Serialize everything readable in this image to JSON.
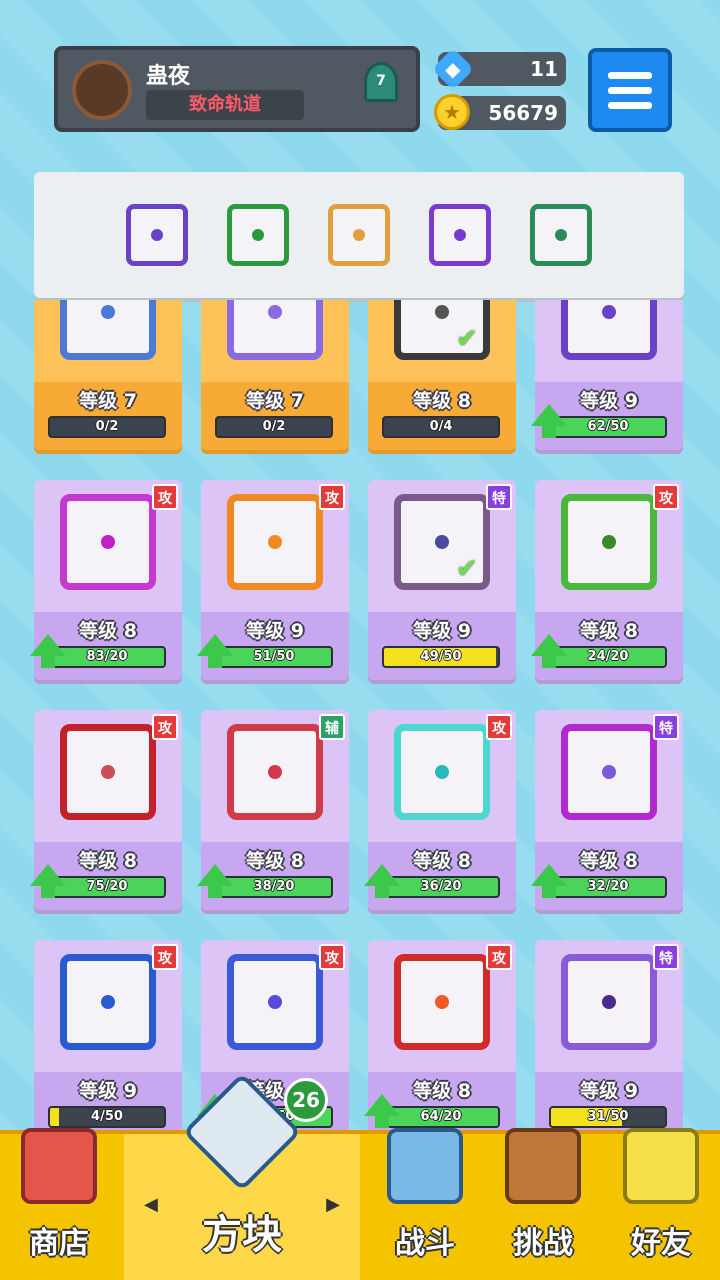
{
  "player": {
    "name": "蛊夜",
    "title": "致命轨道",
    "rank": "7"
  },
  "currency": {
    "gems": "11",
    "coins": "56679"
  },
  "colors": {
    "green": "#4ad45a",
    "yellow": "#f3e11e",
    "attack": "#e43a3a",
    "support": "#2aa36a",
    "special": "#8a3ee0"
  },
  "equipped": [
    {
      "name": "saw-dice",
      "color": "#6a42c8"
    },
    {
      "name": "poison-dice",
      "color": "#2a9a3a"
    },
    {
      "name": "rainbow-dice",
      "color": "#e0a040"
    },
    {
      "name": "orbit-dice",
      "color": "#7a3ad0"
    },
    {
      "name": "wind-dice",
      "color": "#2a8a5a"
    }
  ],
  "cards": [
    {
      "level": "等级 7",
      "progress": "0/2",
      "fill": 0,
      "bar": "green",
      "tag": "",
      "frame": "#4a7ad6",
      "pip": "#4a7ad6",
      "orange": true,
      "arrow": false,
      "check": false
    },
    {
      "level": "等级 7",
      "progress": "0/2",
      "fill": 0,
      "bar": "green",
      "tag": "",
      "frame": "#8a6ae0",
      "pip": "#8a6ae0",
      "orange": true,
      "arrow": false,
      "check": false
    },
    {
      "level": "等级 8",
      "progress": "0/4",
      "fill": 0,
      "bar": "green",
      "tag": "",
      "frame": "#3a3a3a",
      "pip": "#555",
      "orange": true,
      "arrow": false,
      "check": true
    },
    {
      "level": "等级 9",
      "progress": "62/50",
      "fill": 1,
      "bar": "green",
      "tag": "",
      "frame": "#6a42c8",
      "pip": "#6a42c8",
      "orange": false,
      "arrow": true,
      "check": false
    },
    {
      "level": "等级 8",
      "progress": "83/20",
      "fill": 1,
      "bar": "green",
      "tag": "攻",
      "tagtype": "atk",
      "frame": "#c43ad0",
      "pip": "#c020c8",
      "orange": false,
      "arrow": true,
      "check": false
    },
    {
      "level": "等级 9",
      "progress": "51/50",
      "fill": 1,
      "bar": "green",
      "tag": "攻",
      "tagtype": "atk",
      "frame": "#f08a20",
      "pip": "#f08a20",
      "orange": false,
      "arrow": true,
      "check": false
    },
    {
      "level": "等级 9",
      "progress": "49/50",
      "fill": 0.98,
      "bar": "yellow",
      "tag": "特",
      "tagtype": "spc",
      "frame": "#7a5a8a",
      "pip": "#4a4aa0",
      "orange": false,
      "arrow": false,
      "check": true
    },
    {
      "level": "等级 8",
      "progress": "24/20",
      "fill": 1,
      "bar": "green",
      "tag": "攻",
      "tagtype": "atk",
      "frame": "#4ab83a",
      "pip": "#3a8a2a",
      "orange": false,
      "arrow": true,
      "check": false
    },
    {
      "level": "等级 8",
      "progress": "75/20",
      "fill": 1,
      "bar": "green",
      "tag": "攻",
      "tagtype": "atk",
      "frame": "#c4202a",
      "pip": "#d04a5a",
      "orange": false,
      "arrow": true,
      "check": false
    },
    {
      "level": "等级 8",
      "progress": "38/20",
      "fill": 1,
      "bar": "green",
      "tag": "辅",
      "tagtype": "sup",
      "frame": "#d03a4a",
      "pip": "#d03a4a",
      "orange": false,
      "arrow": true,
      "check": false
    },
    {
      "level": "等级 8",
      "progress": "36/20",
      "fill": 1,
      "bar": "green",
      "tag": "攻",
      "tagtype": "atk",
      "frame": "#4ad8d0",
      "pip": "#2ab8b8",
      "orange": false,
      "arrow": true,
      "check": false
    },
    {
      "level": "等级 8",
      "progress": "32/20",
      "fill": 1,
      "bar": "green",
      "tag": "特",
      "tagtype": "spc",
      "frame": "#b02ad0",
      "pip": "#7a5ad8",
      "orange": false,
      "arrow": true,
      "check": false
    },
    {
      "level": "等级 9",
      "progress": "4/50",
      "fill": 0.08,
      "bar": "yellow",
      "tag": "攻",
      "tagtype": "atk",
      "frame": "#2a5ad0",
      "pip": "#2a5ad0",
      "orange": false,
      "arrow": false,
      "check": false
    },
    {
      "level": "等级 9",
      "progress": "55/50",
      "fill": 1,
      "bar": "green",
      "tag": "攻",
      "tagtype": "atk",
      "frame": "#3a5ad8",
      "pip": "#5a4ad8",
      "orange": false,
      "arrow": true,
      "check": false
    },
    {
      "level": "等级 8",
      "progress": "64/20",
      "fill": 1,
      "bar": "green",
      "tag": "攻",
      "tagtype": "atk",
      "frame": "#d02a2a",
      "pip": "#f05a2a",
      "orange": false,
      "arrow": true,
      "check": false
    },
    {
      "level": "等级 9",
      "progress": "31/50",
      "fill": 0.62,
      "bar": "yellow",
      "tag": "特",
      "tagtype": "spc",
      "frame": "#8a5ad8",
      "pip": "#4a2a8a",
      "orange": false,
      "arrow": false,
      "check": false
    }
  ],
  "nav": {
    "shop": "商店",
    "dice": "方块",
    "battle": "战斗",
    "challenge": "挑战",
    "friends": "好友",
    "dice_count": "26",
    "prev_arrow": "◀",
    "next_arrow": "▶"
  }
}
